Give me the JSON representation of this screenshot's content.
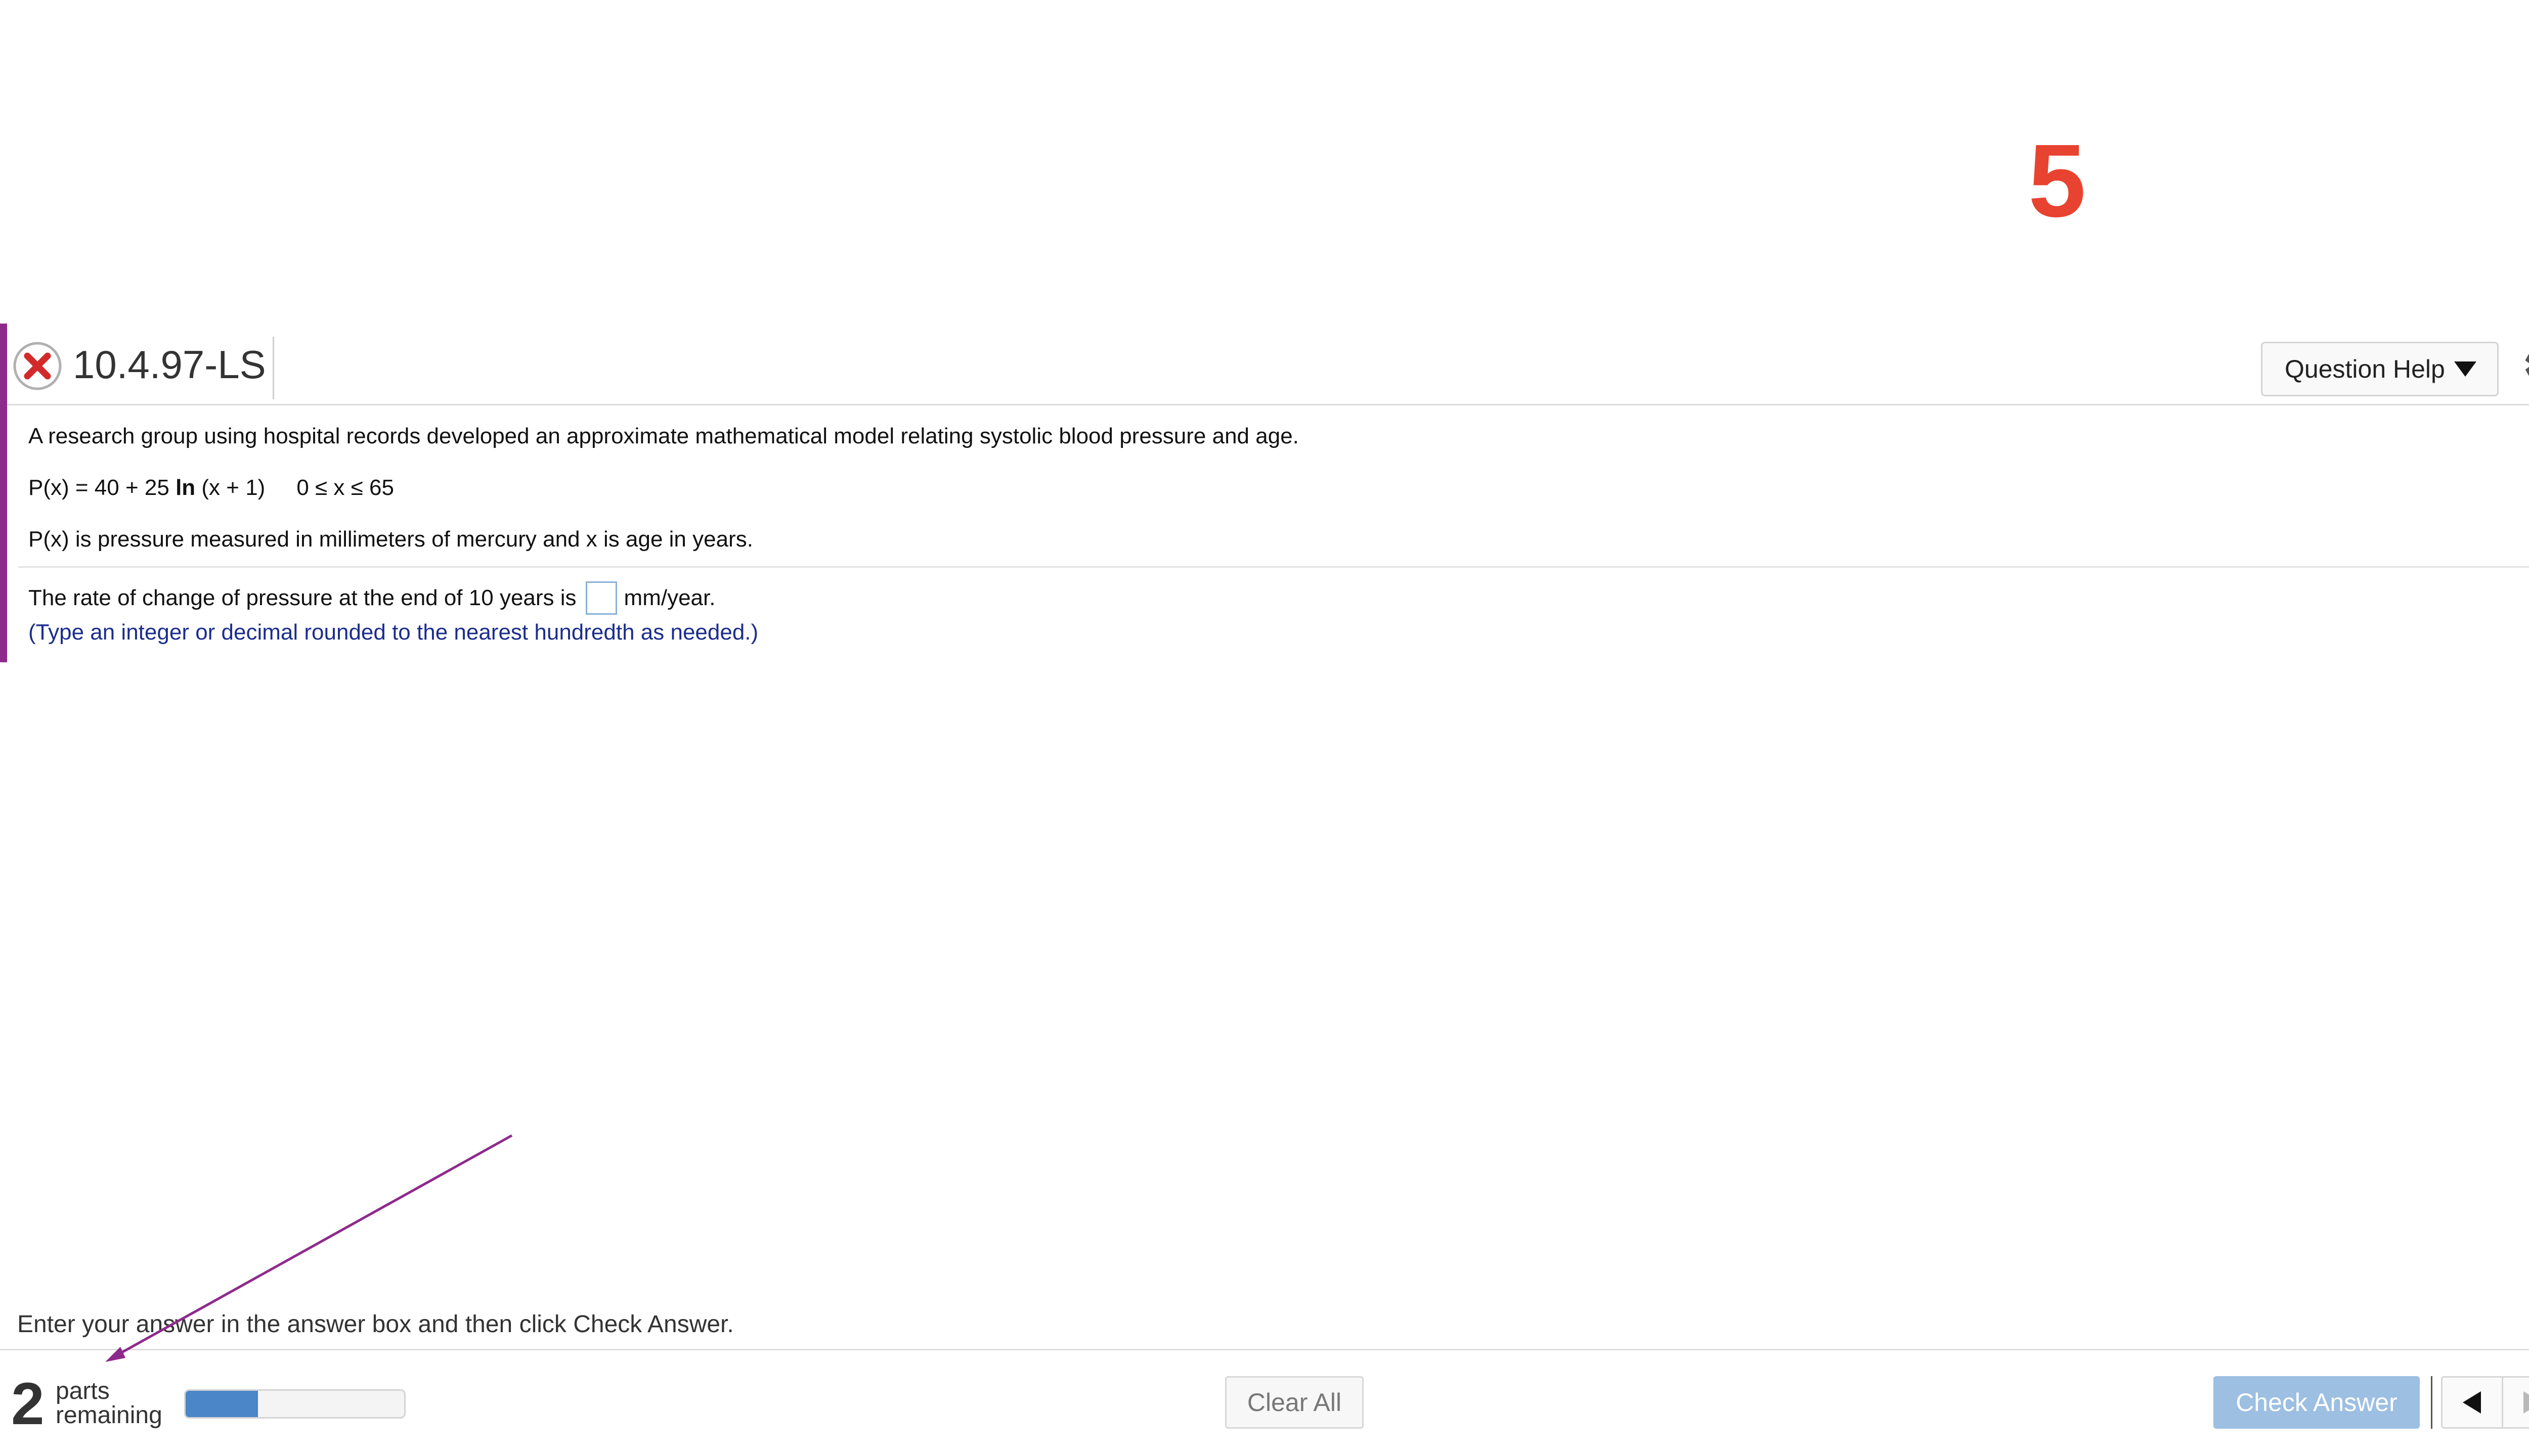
{
  "overlay": {
    "number": "5",
    "number_color": "#e84330"
  },
  "question": {
    "id": "10.4.97-LS",
    "status": "incorrect",
    "status_icon": "x-circle-icon",
    "accent_color": "#8e2a8c",
    "help_button_label": "Question Help",
    "settings_icon": "gear-icon"
  },
  "body": {
    "intro": "A research group using hospital records developed an approximate mathematical model relating systolic blood pressure and age.",
    "formula_lhs": "P(x) = 40 + 25 ",
    "formula_fn": "ln",
    "formula_rest": " (x + 1)",
    "domain": "0 ≤ x ≤ 65",
    "definition": "P(x) is pressure measured in millimeters of mercury and x is age in years.",
    "answer_prefix": "The rate of change of pressure at the end of 10 years is",
    "answer_value": "",
    "answer_suffix": "mm/year.",
    "hint": "(Type an integer or decimal rounded to the nearest hundredth as needed.)"
  },
  "footer": {
    "instruction": "Enter your answer in the answer box and then click Check Answer.",
    "parts_count": "2",
    "parts_word": "parts",
    "parts_word2": "remaining",
    "progress_fraction": 0.33,
    "clear_label": "Clear All",
    "check_label": "Check Answer",
    "prev_icon": "left-triangle-icon",
    "next_icon": "right-triangle-icon",
    "help_icon": "question-circle-icon"
  },
  "annotation": {
    "type": "arrow",
    "color": "#8e2a8c"
  }
}
